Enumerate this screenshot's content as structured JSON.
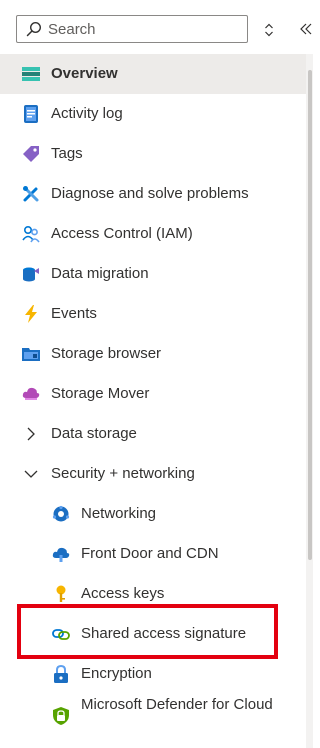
{
  "search": {
    "placeholder": "Search",
    "value": ""
  },
  "menu": {
    "items": [
      {
        "label": "Overview"
      },
      {
        "label": "Activity log"
      },
      {
        "label": "Tags"
      },
      {
        "label": "Diagnose and solve problems"
      },
      {
        "label": "Access Control (IAM)"
      },
      {
        "label": "Data migration"
      },
      {
        "label": "Events"
      },
      {
        "label": "Storage browser"
      },
      {
        "label": "Storage Mover"
      },
      {
        "label": "Data storage"
      },
      {
        "label": "Security + networking"
      },
      {
        "label": "Networking"
      },
      {
        "label": "Front Door and CDN"
      },
      {
        "label": "Access keys"
      },
      {
        "label": "Shared access signature"
      },
      {
        "label": "Encryption"
      },
      {
        "label": "Microsoft Defender for Cloud"
      }
    ]
  },
  "colors": {
    "selected_bg": "#edebe9",
    "highlight_border": "#e3000f",
    "azure_blue": "#0078d4"
  },
  "icons": [
    "search-icon",
    "sort-updown-icon",
    "collapse-double-chevron-icon",
    "overview-icon",
    "activity-log-icon",
    "tag-icon",
    "diagnose-tools-icon",
    "access-control-icon",
    "data-migration-icon",
    "events-lightning-icon",
    "storage-browser-icon",
    "storage-mover-icon",
    "chevron-right-icon",
    "chevron-down-icon",
    "networking-icon",
    "front-door-cdn-icon",
    "access-keys-icon",
    "shared-access-signature-icon",
    "encryption-lock-icon",
    "defender-shield-icon"
  ]
}
